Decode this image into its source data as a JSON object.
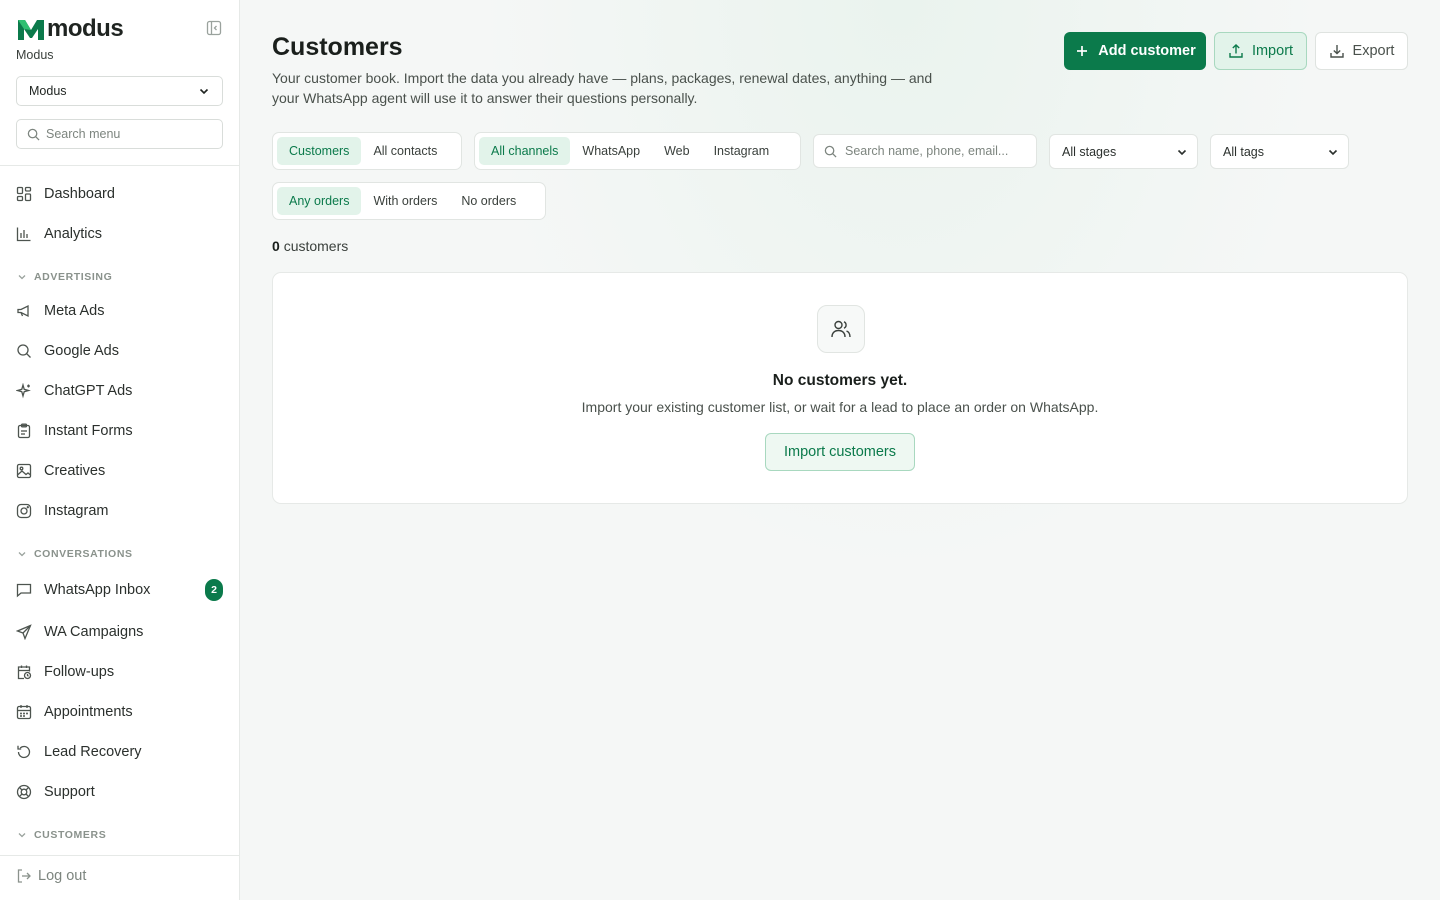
{
  "sidebar": {
    "brand": "modus",
    "org_name": "Modus",
    "org_select": "Modus",
    "search_placeholder": "Search menu",
    "items_top": [
      {
        "label": "Dashboard",
        "icon": "grid-icon"
      },
      {
        "label": "Analytics",
        "icon": "bar-chart-icon"
      }
    ],
    "sections": [
      {
        "title": "ADVERTISING",
        "items": [
          {
            "label": "Meta Ads",
            "icon": "megaphone-icon"
          },
          {
            "label": "Google Ads",
            "icon": "search-icon"
          },
          {
            "label": "ChatGPT Ads",
            "icon": "sparkle-icon"
          },
          {
            "label": "Instant Forms",
            "icon": "clipboard-icon"
          },
          {
            "label": "Creatives",
            "icon": "image-icon"
          },
          {
            "label": "Instagram",
            "icon": "instagram-icon"
          }
        ]
      },
      {
        "title": "CONVERSATIONS",
        "items": [
          {
            "label": "WhatsApp Inbox",
            "icon": "message-icon",
            "badge": "2"
          },
          {
            "label": "WA Campaigns",
            "icon": "send-icon"
          },
          {
            "label": "Follow-ups",
            "icon": "calendar-clock-icon"
          },
          {
            "label": "Appointments",
            "icon": "calendar-icon"
          },
          {
            "label": "Lead Recovery",
            "icon": "rotate-icon"
          },
          {
            "label": "Support",
            "icon": "lifebuoy-icon"
          }
        ]
      },
      {
        "title": "CUSTOMERS",
        "items": []
      }
    ],
    "logout": "Log out"
  },
  "header": {
    "title": "Customers",
    "description": "Your customer book. Import the data you already have — plans, packages, renewal dates, anything — and your WhatsApp agent will use it to answer their questions personally.",
    "add_label": "Add customer",
    "import_label": "Import",
    "export_label": "Export"
  },
  "filters": {
    "type_tabs": [
      "Customers",
      "All contacts"
    ],
    "channel_tabs": [
      "All channels",
      "WhatsApp",
      "Web",
      "Instagram"
    ],
    "search_placeholder": "Search name, phone, email...",
    "stage_select": "All stages",
    "tag_select": "All tags",
    "order_tabs": [
      "Any orders",
      "With orders",
      "No orders"
    ]
  },
  "count": {
    "number": "0",
    "label": "customers"
  },
  "empty": {
    "title": "No customers yet.",
    "description": "Import your existing customer list, or wait for a lead to place an order on WhatsApp.",
    "button": "Import customers"
  },
  "colors": {
    "accent": "#0b7a4b",
    "accent_soft": "#e2f3ea"
  }
}
